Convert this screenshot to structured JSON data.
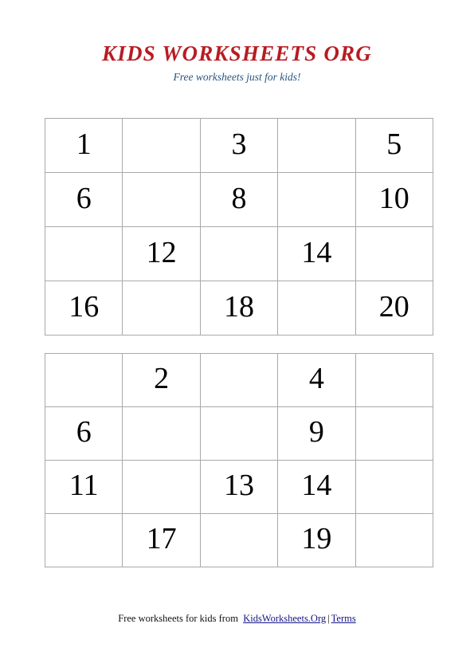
{
  "header": {
    "title": "KIDS WORKSHEETS ORG",
    "tagline": "Free worksheets just for kids!",
    "title_color": "#b81c22",
    "tagline_color": "#28557f"
  },
  "worksheets": [
    {
      "name": "counting-grid-even",
      "rows": [
        [
          "1",
          "",
          "3",
          "",
          "5"
        ],
        [
          "6",
          "",
          "8",
          "",
          "10"
        ],
        [
          "",
          "12",
          "",
          "14",
          ""
        ],
        [
          "16",
          "",
          "18",
          "",
          "20"
        ]
      ]
    },
    {
      "name": "counting-grid-mixed",
      "rows": [
        [
          "",
          "2",
          "",
          "4",
          ""
        ],
        [
          "6",
          "",
          "",
          "9",
          ""
        ],
        [
          "11",
          "",
          "13",
          "14",
          ""
        ],
        [
          "",
          "17",
          "",
          "19",
          ""
        ]
      ]
    }
  ],
  "grid_style": {
    "line_color": "#a9a9a9",
    "number_color": "#000000",
    "columns": 5,
    "rows": 4
  },
  "footer": {
    "text": "Free worksheets for kids from",
    "link_site": "KidsWorksheets.Org",
    "separator": "|",
    "link_terms": "Terms",
    "link_color": "#151585"
  }
}
